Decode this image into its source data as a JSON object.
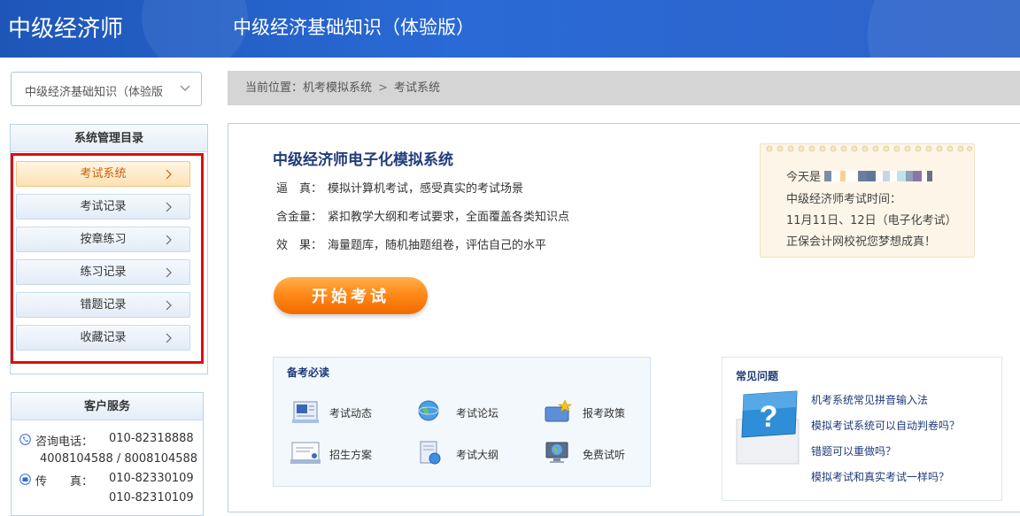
{
  "header": {
    "brand": "中级经济师",
    "course_title": "中级经济基础知识（体验版）"
  },
  "subject_select": {
    "value": "中级经济基础知识（体验版"
  },
  "breadcrumb": {
    "prefix": "当前位置：",
    "level1": "机考模拟系统",
    "separator": ">",
    "level2": "考试系统"
  },
  "sidebar": {
    "title": "系统管理目录",
    "items": [
      {
        "label": "考试系统",
        "active": true
      },
      {
        "label": "考试记录"
      },
      {
        "label": "按章练习"
      },
      {
        "label": "练习记录"
      },
      {
        "label": "错题记录"
      },
      {
        "label": "收藏记录"
      }
    ]
  },
  "customer_service": {
    "title": "客户服务",
    "phone_label": "咨询电话：",
    "phone1": "010-82318888",
    "phone2": "4008104588 / 8008104588",
    "fax_label": "传　　真：",
    "fax1": "010-82330109",
    "fax2": "010-82310109"
  },
  "main": {
    "title": "中级经济师电子化模拟系统",
    "features": [
      {
        "key": "逼　真：",
        "text": "模拟计算机考试，感受真实的考试场景"
      },
      {
        "key": "含金量：",
        "text": "紧扣教学大纲和考试要求，全面覆盖各类知识点"
      },
      {
        "key": "效　果：",
        "text": "海量题库，随机抽题组卷，评估自己的水平"
      }
    ],
    "start_button": "开始考试"
  },
  "notice": {
    "line1_prefix": "今天是",
    "line2": "中级经济师考试时间：",
    "line3": "11月11日、12日（电子化考试）",
    "line4": "正保会计网校祝您梦想成真！"
  },
  "study": {
    "title": "备考必读",
    "items": [
      {
        "label": "考试动态",
        "icon": "newsletter-icon"
      },
      {
        "label": "考试论坛",
        "icon": "globe-icon"
      },
      {
        "label": "报考政策",
        "icon": "star-folder-icon"
      },
      {
        "label": "招生方案",
        "icon": "certificate-icon"
      },
      {
        "label": "考试大纲",
        "icon": "document-globe-icon"
      },
      {
        "label": "免费试听",
        "icon": "monitor-globe-icon"
      }
    ]
  },
  "faq": {
    "title": "常见问题",
    "items": [
      "机考系统常见拼音输入法",
      "模拟考试系统可以自动判卷吗？",
      "错题可以重做吗？",
      "模拟考试和真实考试一样吗？"
    ]
  },
  "colors": {
    "header_blue": "#2a6ad6",
    "active_orange": "#c8620a",
    "highlight_red": "#e00d0d",
    "title_navy": "#1f3c7a"
  }
}
